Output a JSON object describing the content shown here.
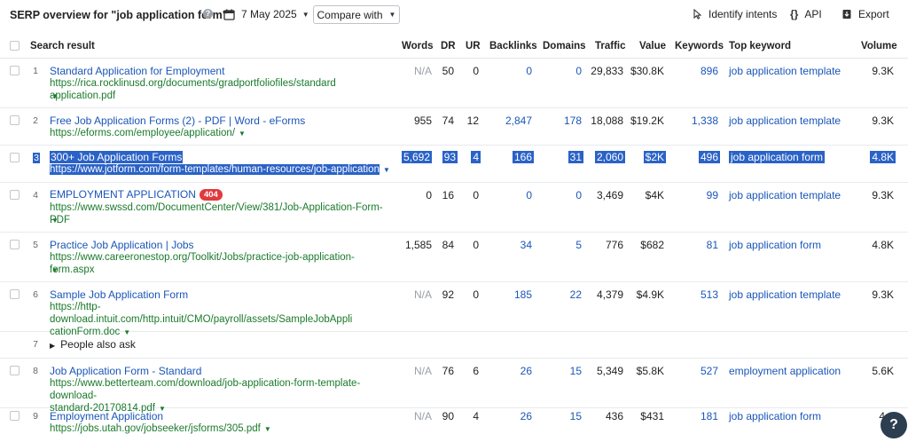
{
  "toolbar": {
    "title": "SERP overview for \"job application form\"",
    "help_glyph": "?",
    "date": "7 May 2025",
    "compare_label": "Compare with",
    "identify_label": "Identify intents",
    "api_label": "API",
    "export_label": "Export"
  },
  "columns": {
    "search_result": "Search result",
    "words": "Words",
    "dr": "DR",
    "ur": "UR",
    "backlinks": "Backlinks",
    "domains": "Domains",
    "traffic": "Traffic",
    "value": "Value",
    "keywords": "Keywords",
    "top_keyword": "Top keyword",
    "volume": "Volume"
  },
  "rows": [
    {
      "num": "1",
      "title": "Standard Application for Employment",
      "url": "https://rica.rocklinusd.org/documents/gradportfoliofiles/standard application.pdf",
      "words": "N/A",
      "dr": "50",
      "ur": "0",
      "backlinks": "0",
      "domains": "0",
      "traffic": "29,833",
      "value": "$30.8K",
      "keywords": "896",
      "top_keyword": "job application template",
      "volume": "9.3K"
    },
    {
      "num": "2",
      "title": "Free Job Application Forms (2) - PDF | Word - eForms",
      "url": "https://eforms.com/employee/application/",
      "words": "955",
      "dr": "74",
      "ur": "12",
      "backlinks": "2,847",
      "domains": "178",
      "traffic": "18,088",
      "value": "$19.2K",
      "keywords": "1,338",
      "top_keyword": "job application template",
      "volume": "9.3K"
    },
    {
      "num": "3",
      "title": "300+ Job Application Forms",
      "url": "https://www.jotform.com/form-templates/human-resources/job-application",
      "words": "5,692",
      "dr": "93",
      "ur": "4",
      "backlinks": "166",
      "domains": "31",
      "traffic": "2,060",
      "value": "$2K",
      "keywords": "496",
      "top_keyword": "job application form",
      "volume": "4.8K"
    },
    {
      "num": "4",
      "title": "EMPLOYMENT APPLICATION",
      "badge": "404",
      "url": "https://www.swssd.com/DocumentCenter/View/381/Job-Application-Form-PDF",
      "words": "0",
      "dr": "16",
      "ur": "0",
      "backlinks": "0",
      "domains": "0",
      "traffic": "3,469",
      "value": "$4K",
      "keywords": "99",
      "top_keyword": "job application template",
      "volume": "9.3K"
    },
    {
      "num": "5",
      "title": "Practice Job Application | Jobs",
      "url": "https://www.careeronestop.org/Toolkit/Jobs/practice-job-application-form.aspx",
      "words": "1,585",
      "dr": "84",
      "ur": "0",
      "backlinks": "34",
      "domains": "5",
      "traffic": "776",
      "value": "$682",
      "keywords": "81",
      "top_keyword": "job application form",
      "volume": "4.8K"
    },
    {
      "num": "6",
      "title": "Sample Job Application Form",
      "url_line1": "https://http-download.intuit.com/http.intuit/CMO/payroll/assets/SampleJobAppli",
      "url_line2": "cationForm.doc",
      "words": "N/A",
      "dr": "92",
      "ur": "0",
      "backlinks": "185",
      "domains": "22",
      "traffic": "4,379",
      "value": "$4.9K",
      "keywords": "513",
      "top_keyword": "job application template",
      "volume": "9.3K"
    },
    {
      "num": "7",
      "paa": "People also ask"
    },
    {
      "num": "8",
      "title": "Job Application Form - Standard",
      "url_line1": "https://www.betterteam.com/download/job-application-form-template-download-",
      "url_line2": "standard-20170814.pdf",
      "words": "N/A",
      "dr": "76",
      "ur": "6",
      "backlinks": "26",
      "domains": "15",
      "traffic": "5,349",
      "value": "$5.8K",
      "keywords": "527",
      "top_keyword": "employment application",
      "volume": "5.6K"
    },
    {
      "num": "9",
      "title": "Employment Application",
      "url": "https://jobs.utah.gov/jobseeker/jsforms/305.pdf",
      "words": "N/A",
      "dr": "90",
      "ur": "4",
      "backlinks": "26",
      "domains": "15",
      "traffic": "436",
      "value": "$431",
      "keywords": "181",
      "top_keyword": "job application form",
      "volume": "4.8"
    }
  ],
  "icons": {
    "calendar": "calendar-icon",
    "identify": "pointer-icon",
    "api": "braces-icon",
    "export": "export-icon",
    "fab": "help-icon"
  },
  "fab_glyph": "?",
  "colors": {
    "link": "#1a56b8",
    "url": "#1a7a2c",
    "selection": "#2a62c7",
    "badge": "#e0393e"
  }
}
